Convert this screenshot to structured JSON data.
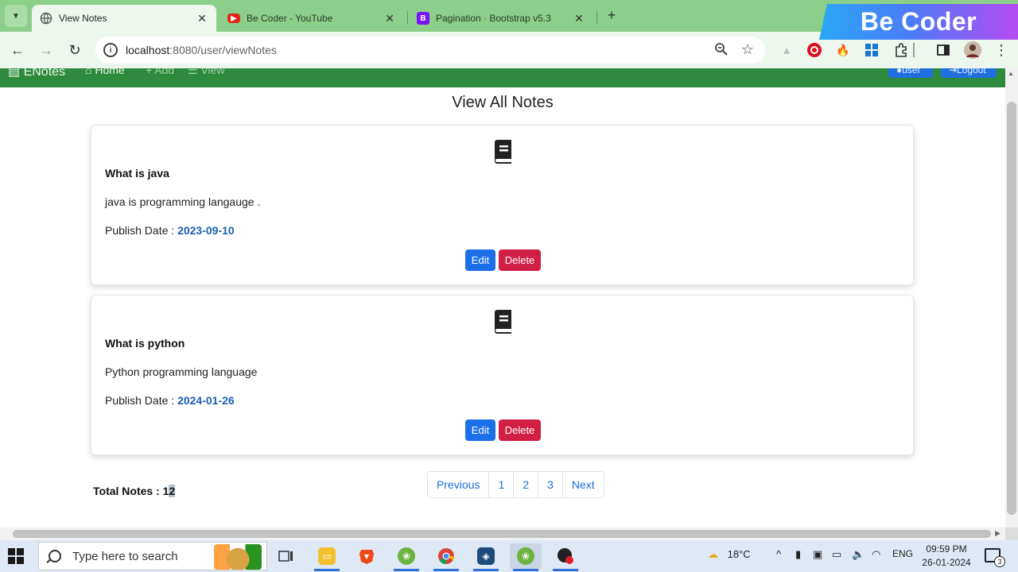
{
  "browser": {
    "tabs": [
      {
        "title": "View Notes",
        "favicon": "globe-icon",
        "active": true
      },
      {
        "title": "Be Coder - YouTube",
        "favicon": "youtube-icon",
        "active": false
      },
      {
        "title": "Pagination · Bootstrap v5.3",
        "favicon": "bootstrap-icon",
        "active": false
      }
    ],
    "url_host": "localhost",
    "url_path": ":8080/user/viewNotes",
    "brand_banner": "Be Coder",
    "colors": {
      "tabstrip": "#8ccf8a",
      "toolbar": "#eef7ee"
    }
  },
  "navbar": {
    "brand": "ENotes",
    "items": [
      "Home",
      "Add",
      "View"
    ],
    "user_label": "user",
    "logout_label": "Logout",
    "color": "#2e8b3e"
  },
  "page": {
    "title": "View All Notes",
    "notes": [
      {
        "title": "What is java",
        "description": "java is programming langauge .",
        "date_label": "Publish Date :",
        "date": "2023-09-10",
        "edit_label": "Edit",
        "delete_label": "Delete"
      },
      {
        "title": "What is python",
        "description": "Python programming language",
        "date_label": "Publish Date :",
        "date": "2024-01-26",
        "edit_label": "Edit",
        "delete_label": "Delete"
      }
    ],
    "total_label": "Total Notes :",
    "total_value_plain": "1",
    "total_value_selected": "2",
    "pagination": [
      "Previous",
      "1",
      "2",
      "3",
      "Next"
    ],
    "colors": {
      "edit": "#1b6fe8",
      "delete": "#d11f44",
      "date": "#1a5fb4",
      "link": "#1a6fe0"
    }
  },
  "taskbar": {
    "search_placeholder": "Type here to search",
    "temperature": "18°C",
    "language": "ENG",
    "time": "09:59 PM",
    "date": "26-01-2024",
    "notification_count": "3"
  }
}
